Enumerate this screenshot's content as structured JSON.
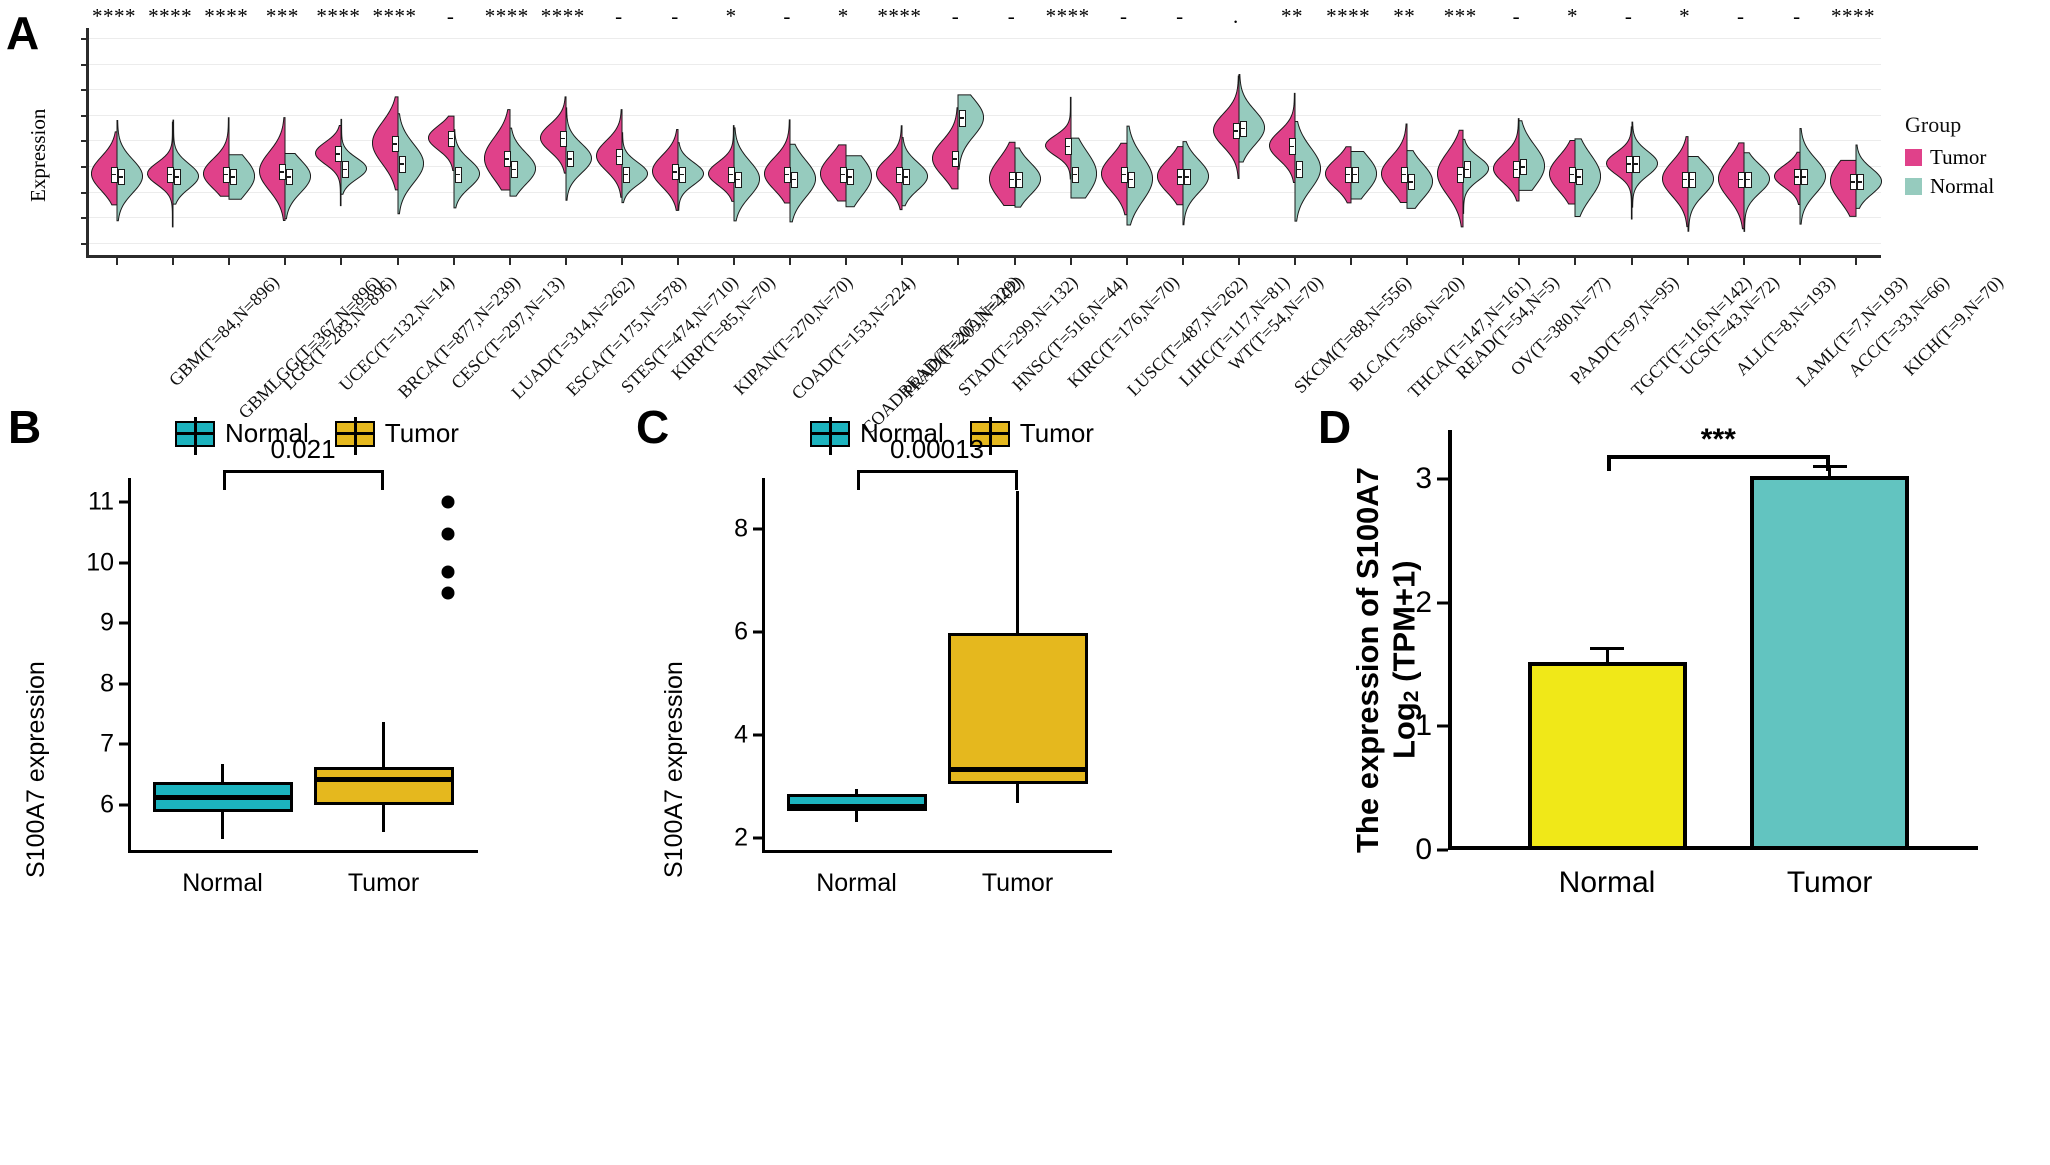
{
  "chart_data": [
    {
      "type": "violin",
      "panel": "A",
      "title": "",
      "ylabel": "Expression",
      "xlabel": "",
      "ylim": [
        -18,
        27
      ],
      "yticks": [
        25,
        20,
        15,
        10,
        5,
        0,
        -5,
        -10,
        -15
      ],
      "grid": true,
      "legend": {
        "title": "Group",
        "position": "right",
        "entries": [
          {
            "name": "Tumor",
            "color": "#E0418A"
          },
          {
            "name": "Normal",
            "color": "#96CBBE"
          }
        ]
      },
      "categories": [
        "GBM(T=84,N=896)",
        "GBMLGG(T=367,N=896)",
        "LGG(T=283,N=896)",
        "UCEC(T=132,N=14)",
        "BRCA(T=877,N=239)",
        "CESC(T=297,N=13)",
        "LUAD(T=314,N=262)",
        "ESCA(T=175,N=578)",
        "STES(T=474,N=710)",
        "KIRP(T=85,N=70)",
        "KIPAN(T=270,N=70)",
        "COAD(T=153,N=224)",
        "COADREAD(T=207,N=229)",
        "PRAD(T=209,N=102)",
        "STAD(T=299,N=132)",
        "HNSC(T=516,N=44)",
        "KIRC(T=176,N=70)",
        "LUSC(T=487,N=262)",
        "LIHC(T=117,N=81)",
        "WT(T=54,N=70)",
        "SKCM(T=88,N=556)",
        "BLCA(T=366,N=20)",
        "THCA(T=147,N=161)",
        "READ(T=54,N=5)",
        "OV(T=380,N=77)",
        "PAAD(T=97,N=95)",
        "TGCT(T=116,N=142)",
        "UCS(T=43,N=72)",
        "ALL(T=8,N=193)",
        "LAML(T=7,N=193)",
        "ACC(T=33,N=66)",
        "KICH(T=9,N=70)"
      ],
      "significance": [
        "****",
        "****",
        "****",
        "***",
        "****",
        "****",
        "-",
        "****",
        "****",
        "-",
        "-",
        "*",
        "-",
        "*",
        "****",
        "-",
        "-",
        "****",
        "-",
        "-",
        ".",
        "**",
        "****",
        "**",
        "***",
        "-",
        "*",
        "-",
        "*",
        "-",
        "-",
        "****"
      ],
      "tumor_median": [
        -1.5,
        -1.5,
        -1.5,
        -1.0,
        2.5,
        4.5,
        5.5,
        1.5,
        5.5,
        2.0,
        -1.0,
        -1.5,
        -1.5,
        -1.5,
        -1.5,
        1.5,
        -2.5,
        4.0,
        -1.5,
        -2.0,
        7.0,
        4.0,
        -1.5,
        -1.5,
        -1.5,
        -0.5,
        -1.5,
        0.5,
        -2.5,
        -2.5,
        -2.0,
        -3.0
      ],
      "normal_median": [
        -2.0,
        -2.0,
        -2.0,
        -2.0,
        -0.5,
        0.5,
        -1.5,
        -0.5,
        1.5,
        -1.5,
        -1.5,
        -2.5,
        -2.5,
        -2.0,
        -2.0,
        9.5,
        -2.5,
        -1.5,
        -2.5,
        -2.0,
        7.5,
        -0.5,
        -1.5,
        -3.0,
        -0.5,
        0.0,
        -2.0,
        0.5,
        -2.5,
        -2.5,
        -2.0,
        -3.0
      ]
    },
    {
      "type": "boxplot",
      "panel": "B",
      "ylabel": "S100A7 expression",
      "ylim": [
        5.2,
        11.4
      ],
      "yticks": [
        11,
        10,
        9,
        8,
        7,
        6
      ],
      "pvalue": "0.021",
      "legend": {
        "position": "top",
        "entries": [
          {
            "name": "Normal",
            "color": "#1CB3BE"
          },
          {
            "name": "Tumor",
            "color": "#E5B81E"
          }
        ]
      },
      "groups": [
        {
          "label": "Normal",
          "color": "#1CB3BE",
          "q1": 5.88,
          "median": 6.12,
          "q3": 6.37,
          "whisker_low": 5.43,
          "whisker_high": 6.67,
          "outliers": []
        },
        {
          "label": "Tumor",
          "color": "#E5B81E",
          "q1": 6.0,
          "median": 6.42,
          "q3": 6.62,
          "whisker_low": 5.55,
          "whisker_high": 7.36,
          "outliers": [
            11.0,
            10.48,
            9.84,
            9.5
          ]
        }
      ]
    },
    {
      "type": "boxplot",
      "panel": "C",
      "ylabel": "S100A7 expression",
      "ylim": [
        1.7,
        9.0
      ],
      "yticks": [
        8,
        6,
        4,
        2
      ],
      "pvalue": "0.00013",
      "legend": {
        "position": "top",
        "entries": [
          {
            "name": "Normal",
            "color": "#1CB3BE"
          },
          {
            "name": "Tumor",
            "color": "#E5B81E"
          }
        ]
      },
      "groups": [
        {
          "label": "Normal",
          "color": "#1CB3BE",
          "q1": 2.52,
          "median": 2.62,
          "q3": 2.85,
          "whisker_low": 2.3,
          "whisker_high": 2.95,
          "outliers": []
        },
        {
          "label": "Tumor",
          "color": "#E5B81E",
          "q1": 3.05,
          "median": 3.33,
          "q3": 5.98,
          "whisker_low": 2.68,
          "whisker_high": 8.75,
          "outliers": []
        }
      ]
    },
    {
      "type": "bar",
      "panel": "D",
      "ylabel_line1": "The expression of S100A7",
      "ylabel_line2_pre": "Log",
      "ylabel_line2_sub": "2",
      "ylabel_line2_post": " (TPM+1)",
      "ylim": [
        0,
        3.4
      ],
      "yticks": [
        3,
        2,
        1,
        0
      ],
      "significance": "***",
      "categories": [
        "Normal",
        "Tumor"
      ],
      "values": [
        1.52,
        3.03
      ],
      "errors": [
        0.12,
        0.09
      ],
      "colors": [
        "#F0E818",
        "#62C4C0"
      ]
    }
  ],
  "panels": {
    "a": {
      "letter": "A"
    },
    "b": {
      "letter": "B"
    },
    "c": {
      "letter": "C"
    },
    "d": {
      "letter": "D"
    }
  }
}
